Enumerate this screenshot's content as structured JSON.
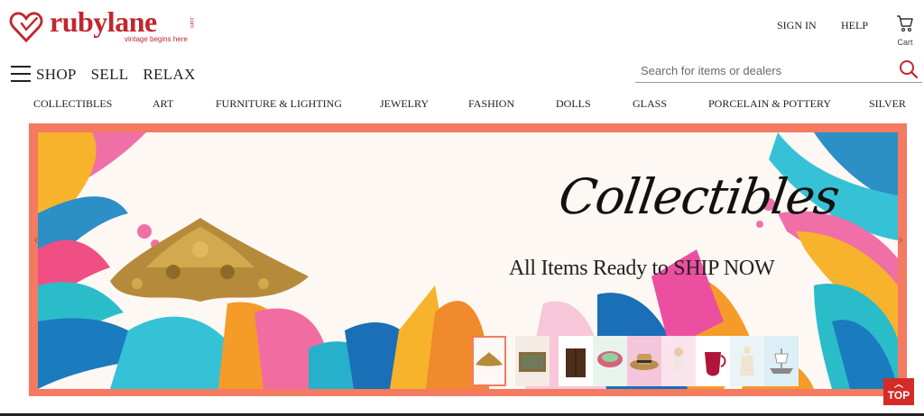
{
  "header": {
    "logo_text": "rubylane",
    "logo_suffix": ".com",
    "tagline": "vintage begins here",
    "sign_in": "SIGN IN",
    "help": "HELP",
    "cart_label": "Cart"
  },
  "nav": {
    "shop": "SHOP",
    "sell": "SELL",
    "relax": "RELAX"
  },
  "search": {
    "placeholder": "Search for items or dealers"
  },
  "categories": [
    "COLLECTIBLES",
    "ART",
    "FURNITURE & LIGHTING",
    "JEWELRY",
    "FASHION",
    "DOLLS",
    "GLASS",
    "PORCELAIN & POTTERY",
    "SILVER"
  ],
  "banner": {
    "title": "Collectibles",
    "subtitle": "All Items Ready to SHIP NOW",
    "prev": "‹",
    "next": "›"
  },
  "thumbnails": [
    "gold-ornament",
    "framed-painting",
    "wood-cabinet",
    "glass-bowl",
    "straw-hat",
    "doll",
    "ruby-pitcher",
    "porcelain-figurine",
    "ship-model"
  ],
  "top_button": "TOP",
  "colors": {
    "brand": "#c0272d",
    "banner_border": "#f47a61",
    "top_button": "#d42b27"
  }
}
